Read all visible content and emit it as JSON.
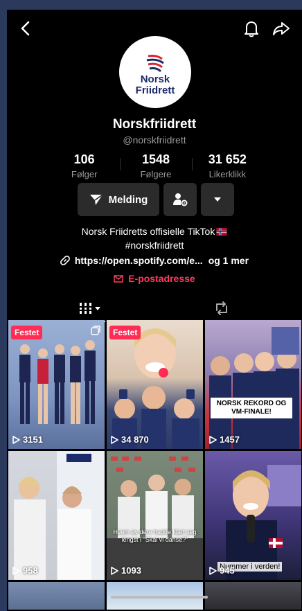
{
  "profile": {
    "display_name": "Norskfriidrett",
    "handle": "@norskfriidrett",
    "logo_text_1": "Norsk",
    "logo_text_2": "Friidrett"
  },
  "stats": [
    {
      "value": "106",
      "label": "Følger"
    },
    {
      "value": "1548",
      "label": "Følgere"
    },
    {
      "value": "31 652",
      "label": "Likerklikk"
    }
  ],
  "actions": {
    "message_label": "Melding"
  },
  "bio": {
    "line1": "Norsk Friidretts offisielle TikTok",
    "line2": "#norskfriidrett",
    "link": "https://open.spotify.com/e...",
    "more": "og 1 mer",
    "email_label": "E-postadresse"
  },
  "videos": [
    {
      "views": "3151",
      "pinned": "Festet"
    },
    {
      "views": "34 870",
      "pinned": "Festet"
    },
    {
      "views": "1457",
      "caption": "NORSK REKORD OG VM-FINALE!"
    },
    {
      "views": "958"
    },
    {
      "views": "1093",
      "subtitle": "Hvem av dere hadde klart seg lengst i \"Skal vi danse?\""
    },
    {
      "views": "945",
      "overlay": "Nummer  i verden!"
    }
  ],
  "colors": {
    "accent": "#ff2c55",
    "email": "#ff3b5c",
    "background": "#000000",
    "button": "#2b2b2b"
  }
}
